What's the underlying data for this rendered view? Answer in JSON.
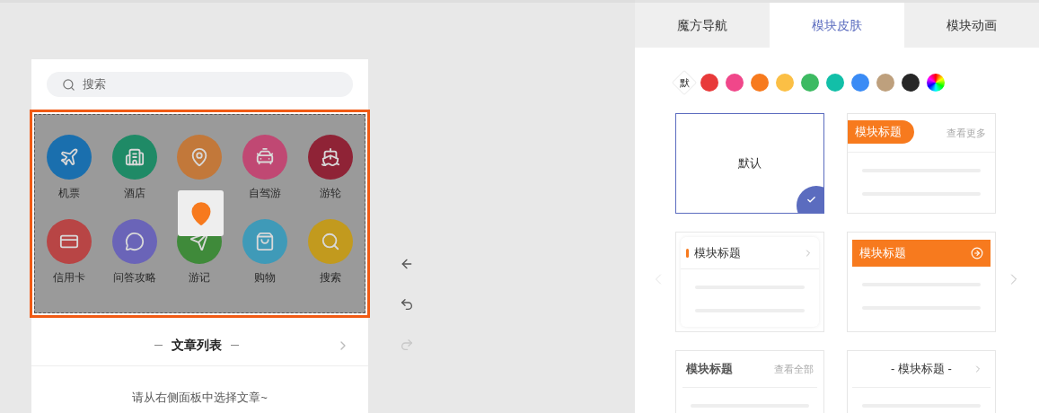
{
  "search": {
    "placeholder": "搜索"
  },
  "nav_grid": {
    "items": [
      {
        "label": "机票",
        "color": "#1a6fae"
      },
      {
        "label": "酒店",
        "color": "#1f8a66"
      },
      {
        "color": "#c2783a"
      },
      {
        "label": "自驾游",
        "color": "#c04873"
      },
      {
        "label": "游轮",
        "color": "#8f2336"
      },
      {
        "label": "信用卡",
        "color": "#b84545"
      },
      {
        "label": "问答攻略",
        "color": "#6a64b8"
      },
      {
        "label": "游记",
        "color": "#3f8a3a"
      },
      {
        "label": "购物",
        "color": "#3f9ab8"
      },
      {
        "label": "搜索",
        "color": "#c29a1e"
      }
    ]
  },
  "article_list": {
    "title": "文章列表",
    "empty_text": "请从右侧面板中选择文章~"
  },
  "toolbar": [
    {
      "kind": "back",
      "disabled": false
    },
    {
      "kind": "undo",
      "disabled": false
    },
    {
      "kind": "redo",
      "disabled": true
    }
  ],
  "tabs": [
    {
      "label": "魔方导航",
      "selected": false
    },
    {
      "label": "模块皮肤",
      "selected": true
    },
    {
      "label": "模块动画",
      "selected": false
    }
  ],
  "swatches": {
    "default_label": "默",
    "colors": [
      {
        "color": "#e83a3a"
      },
      {
        "color": "#f0478a"
      },
      {
        "color": "#f77a1e"
      },
      {
        "color": "#fbbf45"
      },
      {
        "color": "#3dba62"
      },
      {
        "color": "#12bfa8"
      },
      {
        "color": "#3a8bf5"
      },
      {
        "color": "#bea07d"
      },
      {
        "color": "#262626"
      },
      {
        "kind": "rainbow"
      }
    ]
  },
  "skins": [
    {
      "kind": "default",
      "label": "默认",
      "selected": true
    },
    {
      "kind": "pill",
      "title": "模块标题",
      "more": "查看更多",
      "selected": false
    },
    {
      "kind": "accent",
      "title": "模块标题",
      "selected": false
    },
    {
      "kind": "banner",
      "title": "模块标题",
      "selected": false
    },
    {
      "kind": "plain",
      "title": "模块标题",
      "more": "查看全部",
      "selected": false
    },
    {
      "kind": "centered",
      "title": "- 模块标题 -",
      "selected": false
    }
  ]
}
